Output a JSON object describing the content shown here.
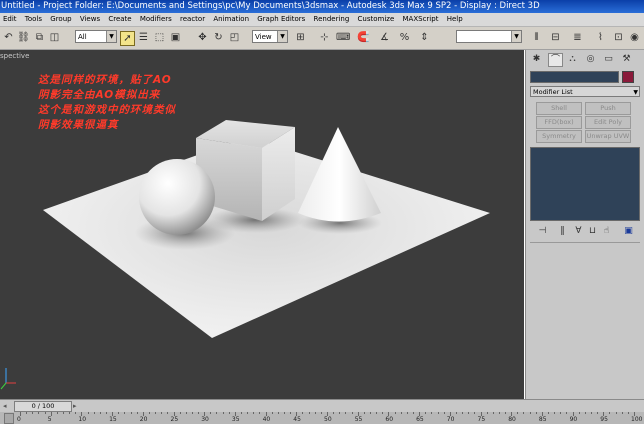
{
  "title_bar": {
    "text": "Untitled     - Project Folder: E:\\Documents and Settings\\pc\\My Documents\\3dsmax     - Autodesk 3ds Max 9 SP2     - Display : Direct 3D"
  },
  "menu": {
    "items": [
      {
        "label": "Edit"
      },
      {
        "label": "Tools"
      },
      {
        "label": "Group"
      },
      {
        "label": "Views"
      },
      {
        "label": "Create"
      },
      {
        "label": "Modifiers"
      },
      {
        "label": "reactor"
      },
      {
        "label": "Animation"
      },
      {
        "label": "Graph Editors"
      },
      {
        "label": "Rendering"
      },
      {
        "label": "Customize"
      },
      {
        "label": "MAXScript"
      },
      {
        "label": "Help"
      }
    ]
  },
  "toolbar": {
    "selection_filter": "All",
    "reference_coord": "View"
  },
  "viewport": {
    "label": "spective",
    "annotation_lines": [
      "这是同样的环境，贴了AO",
      "阴影完全由AO模拟出来",
      "这个是和游戏中的环境类似",
      "阴影效果很逼真"
    ]
  },
  "command_panel": {
    "modifier_list": "Modifier List",
    "buttons": [
      "Shell",
      "Push",
      "FFD(box)",
      "Edit Poly",
      "Symmetry",
      "Unwrap UVW"
    ],
    "accent_color": "#8a1a3a"
  },
  "timeline": {
    "frame_readout": "0 / 100",
    "tick_labels": [
      "0",
      "5",
      "10",
      "15",
      "20",
      "25",
      "30",
      "35",
      "40",
      "45",
      "50",
      "55",
      "60",
      "65",
      "70",
      "75",
      "80",
      "85",
      "90",
      "95",
      "100"
    ]
  },
  "colors": {
    "viewport_bg": "#3c3c3c",
    "panel_bg": "#c8c8c8",
    "stack_bg": "#2f4258",
    "annotation": "#ff3a2a"
  }
}
